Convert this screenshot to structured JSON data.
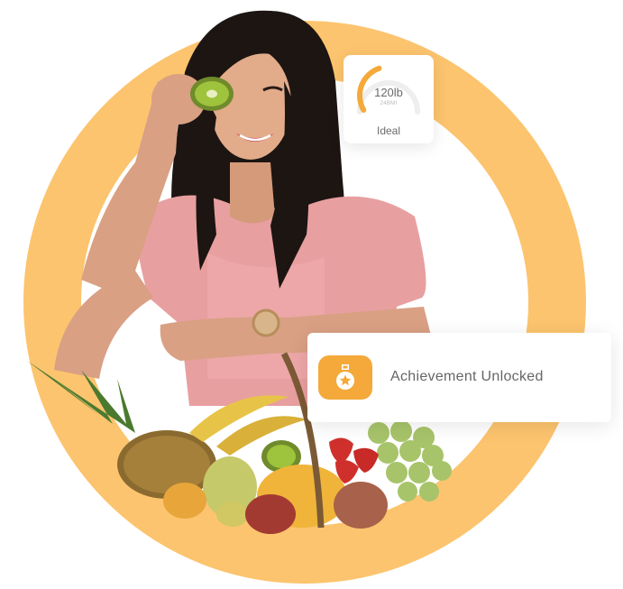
{
  "colors": {
    "ring": "#fcc46e",
    "accent": "#f4a93a",
    "card_bg": "#ffffff",
    "text_muted": "#6b6b6b"
  },
  "hero": {
    "description_icon": "woman-with-fruits-photo"
  },
  "weight_card": {
    "value": "120lb",
    "bmi": "24BMI",
    "status": "Ideal",
    "gauge_fraction": 0.42
  },
  "achievement_card": {
    "icon": "medal-star-icon",
    "label": "Achievement Unlocked"
  }
}
